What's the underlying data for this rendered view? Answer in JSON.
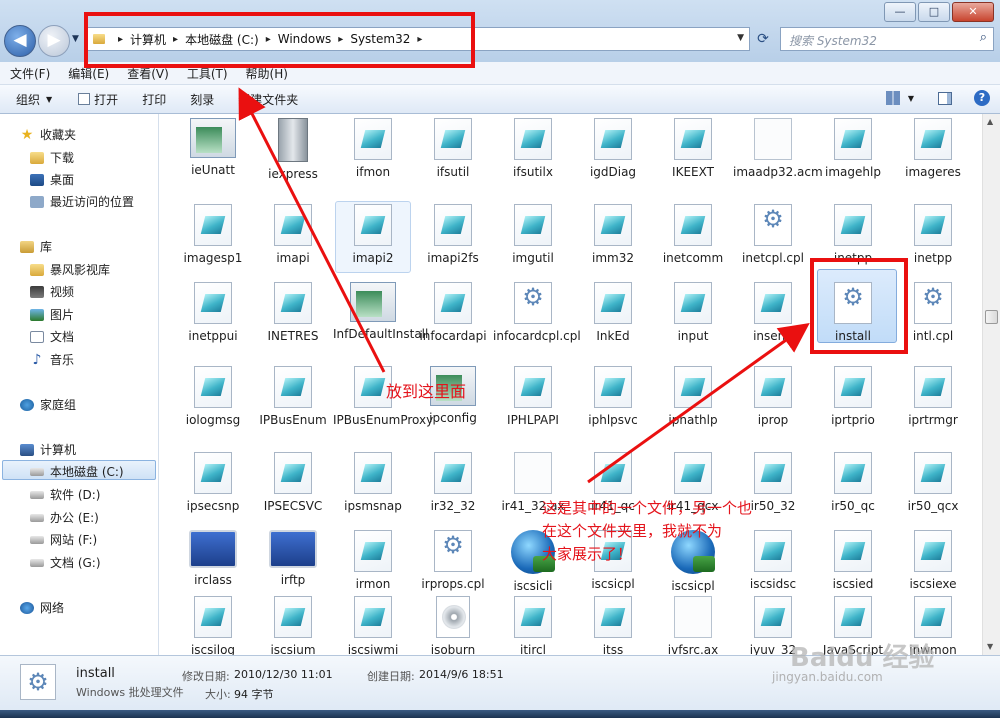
{
  "address": {
    "crumbs": [
      "计算机",
      "本地磁盘 (C:)",
      "Windows",
      "System32"
    ],
    "search_placeholder": "搜索 System32"
  },
  "window_controls": {
    "minimize": "—",
    "maximize": "□",
    "close": "✕"
  },
  "menu": [
    "文件(F)",
    "编辑(E)",
    "查看(V)",
    "工具(T)",
    "帮助(H)"
  ],
  "toolbar": {
    "organize": "组织",
    "open": "打开",
    "print": "打印",
    "burn": "刻录",
    "new_folder": "新建文件夹"
  },
  "nav": {
    "favorites": "收藏夹",
    "downloads": "下载",
    "desktop": "桌面",
    "recent": "最近访问的位置",
    "libraries": "库",
    "storm": "暴风影视库",
    "videos": "视频",
    "pictures": "图片",
    "documents": "文档",
    "music": "音乐",
    "homegroup": "家庭组",
    "computer": "计算机",
    "drive_c": "本地磁盘 (C:)",
    "drive_d": "软件 (D:)",
    "drive_e": "办公 (E:)",
    "drive_f": "网站 (F:)",
    "drive_g": "文档 (G:)",
    "network": "网络"
  },
  "files": [
    [
      "ieUnatt",
      "iexpress",
      "ifmon",
      "ifsutil",
      "ifsutilx",
      "igdDiag",
      "IKEEXT",
      "imaadp32.acm",
      "imagehlp",
      "imageres"
    ],
    [
      "imagesp1",
      "imapi",
      "imapi2",
      "imapi2fs",
      "imgutil",
      "imm32",
      "inetcomm",
      "inetcpl.cpl",
      "inetpp",
      "inetpp"
    ],
    [
      "inetppui",
      "INETRES",
      "InfDefaultInstall",
      "infocardapi",
      "infocardcpl.cpl",
      "InkEd",
      "input",
      "inseng",
      "install",
      "intl.cpl"
    ],
    [
      "iologmsg",
      "IPBusEnum",
      "IPBusEnumProxy",
      "ipconfig",
      "IPHLPAPI",
      "iphlpsvc",
      "ipnathlp",
      "iprop",
      "iprtprio",
      "iprtrmgr"
    ],
    [
      "ipsecsnp",
      "IPSECSVC",
      "ipsmsnap",
      "ir32_32",
      "ir41_32.ax",
      "ir41_qc",
      "ir41_qcx",
      "ir50_32",
      "ir50_qc",
      "ir50_qcx"
    ],
    [
      "irclass",
      "irftp",
      "irmon",
      "irprops.cpl",
      "iscsicli",
      "iscsicpl",
      "iscsicpl",
      "iscsidsc",
      "iscsied",
      "iscsiexe"
    ],
    [
      "iscsilog",
      "iscsium",
      "iscsiwmi",
      "isoburn",
      "itircl",
      "itss",
      "ivfsrc.ax",
      "iyuv_32",
      "JavaScript",
      "jnwmon"
    ]
  ],
  "details": {
    "name": "install",
    "type": "Windows 批处理文件",
    "modified_label": "修改日期:",
    "modified": "2010/12/30 11:01",
    "created_label": "创建日期:",
    "created": "2014/9/6 18:51",
    "size_label": "大小:",
    "size": "94 字节"
  },
  "annotations": {
    "arrow1": "放到这里面",
    "arrow2_line1": "这是其中的一个文件，另一个也",
    "arrow2_line2": "在这个文件夹里，我就不为",
    "arrow2_line3": "大家展示了！"
  },
  "watermark": {
    "brand": "Baidu 经验",
    "url": "jingyan.baidu.com"
  },
  "colors": {
    "annotation": "#ea1010",
    "selection": "#c1dcf8"
  }
}
